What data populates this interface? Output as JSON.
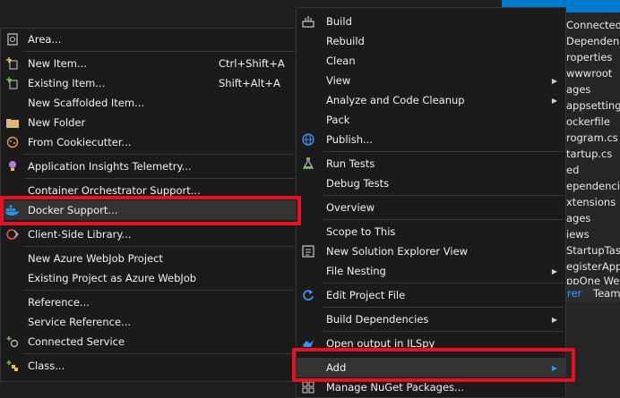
{
  "solution_explorer": {
    "items": [
      "Connected S",
      "Dependenci",
      "roperties",
      "wwwroot",
      "ages",
      "appsettings.j",
      "ockerfile",
      "rogram.cs",
      "tartup.cs",
      "ed",
      "ependencie",
      "xtensions",
      "ages",
      "iews",
      "StartupTask.",
      "egisterAppl",
      "ppOne We"
    ],
    "tabs": [
      "rer",
      "Team"
    ]
  },
  "left_menu": {
    "items": [
      {
        "label": "Area...",
        "icon": "area-icon"
      },
      {
        "label": "New Item...",
        "shortcut": "Ctrl+Shift+A",
        "icon": "new-item-icon"
      },
      {
        "label": "Existing Item...",
        "shortcut": "Shift+Alt+A",
        "icon": "existing-item-icon"
      },
      {
        "label": "New Scaffolded Item..."
      },
      {
        "label": "New Folder",
        "icon": "folder-icon"
      },
      {
        "label": "From Cookiecutter...",
        "icon": "cookiecutter-icon"
      },
      {
        "label": "Application Insights Telemetry...",
        "icon": "app-insights-icon"
      },
      {
        "label": "Container Orchestrator Support..."
      },
      {
        "label": "Docker Support...",
        "icon": "docker-icon"
      },
      {
        "label": "Client-Side Library...",
        "icon": "library-icon"
      },
      {
        "label": "New Azure WebJob Project"
      },
      {
        "label": "Existing Project as Azure WebJob"
      },
      {
        "label": "Reference..."
      },
      {
        "label": "Service Reference..."
      },
      {
        "label": "Connected Service",
        "icon": "connected-service-icon"
      },
      {
        "label": "Class...",
        "icon": "class-icon"
      }
    ]
  },
  "right_menu": {
    "items": [
      {
        "label": "Build",
        "icon": "build-icon"
      },
      {
        "label": "Rebuild"
      },
      {
        "label": "Clean"
      },
      {
        "label": "View"
      },
      {
        "label": "Analyze and Code Cleanup"
      },
      {
        "label": "Pack"
      },
      {
        "label": "Publish...",
        "icon": "globe-icon"
      },
      {
        "label": "Run Tests",
        "icon": "flask-icon"
      },
      {
        "label": "Debug Tests"
      },
      {
        "label": "Overview"
      },
      {
        "label": "Scope to This"
      },
      {
        "label": "New Solution Explorer View",
        "icon": "new-view-icon"
      },
      {
        "label": "File Nesting"
      },
      {
        "label": "Edit Project File",
        "icon": "refresh-icon"
      },
      {
        "label": "Build Dependencies"
      },
      {
        "label": "Open output in ILSpy",
        "icon": "ilspy-icon"
      },
      {
        "label": "Add"
      },
      {
        "label": "Manage NuGet Packages...",
        "icon": "nuget-icon"
      }
    ]
  },
  "colors": {
    "menu_bg": "#1b1b1c",
    "highlight": "#333334",
    "annotation_red": "#e81123",
    "selection_blue": "#007acc"
  }
}
